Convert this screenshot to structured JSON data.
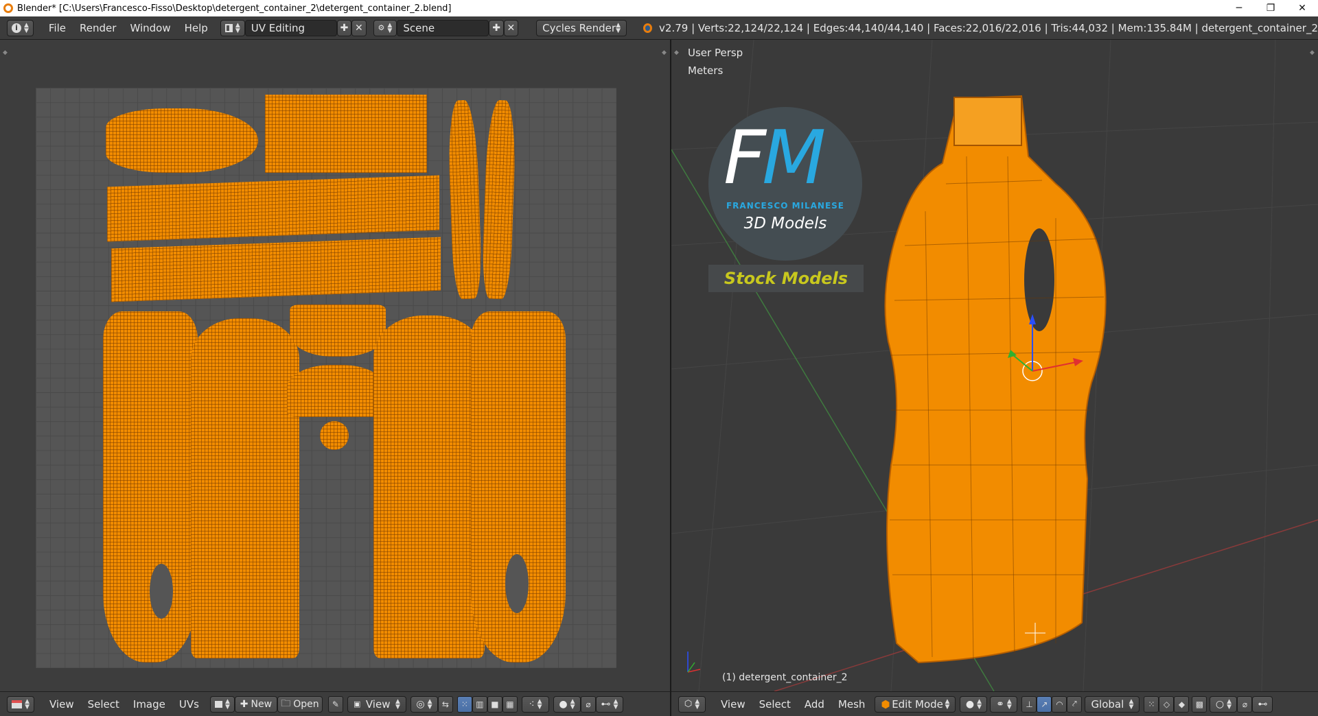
{
  "title": {
    "text": "Blender* [C:\\Users\\Francesco-Fisso\\Desktop\\detergent_container_2\\detergent_container_2.blend]"
  },
  "window_controls": {
    "minimize": "─",
    "maximize": "❐",
    "close": "✕"
  },
  "info_header": {
    "menus": [
      "File",
      "Render",
      "Window",
      "Help"
    ],
    "screen_layout": "UV Editing",
    "scene": "Scene",
    "render_engine": "Cycles Render",
    "stats": "v2.79 | Verts:22,124/22,124 | Edges:44,140/44,140 | Faces:22,016/22,016 | Tris:44,032 | Mem:135.84M | detergent_container_2"
  },
  "uv_editor": {
    "menus": [
      "View",
      "Select",
      "Image",
      "UVs"
    ],
    "new_label": "New",
    "open_label": "Open",
    "view_label": "View"
  },
  "viewport": {
    "view_name": "User Persp",
    "units": "Meters",
    "object_label": "(1) detergent_container_2",
    "menus": [
      "View",
      "Select",
      "Add",
      "Mesh"
    ],
    "mode": "Edit Mode",
    "orientation": "Global"
  },
  "logo": {
    "letters_f": "F",
    "letters_m": "M",
    "name": "FRANCESCO MILANESE",
    "subtitle": "3D Models",
    "badge": "Stock Models"
  },
  "colors": {
    "accent": "#f28c00",
    "logo_blue": "#29a8e0",
    "badge_text": "#c8c81e"
  }
}
